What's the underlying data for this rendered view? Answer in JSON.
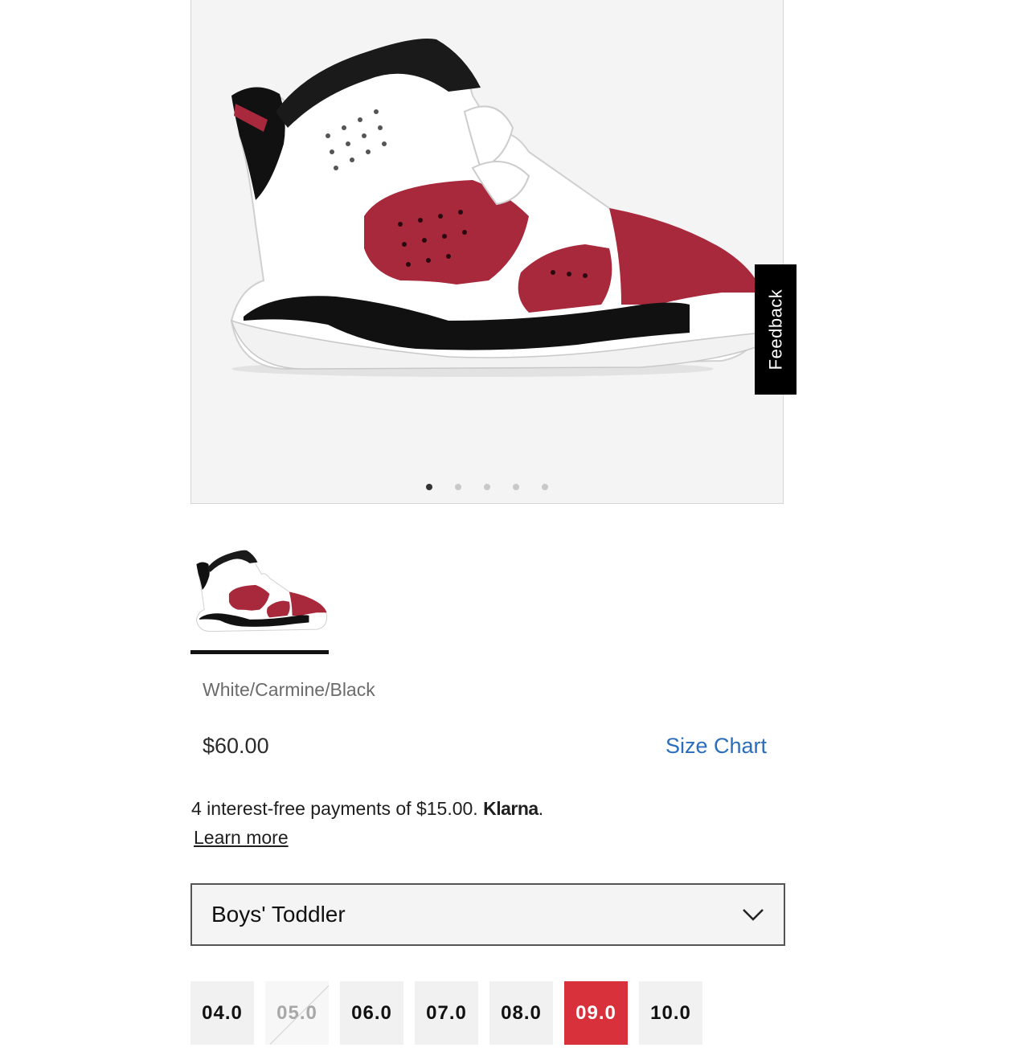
{
  "gallery": {
    "image": "product-shoe-image",
    "dots": 5,
    "active_dot": 1
  },
  "feedback": {
    "label": "Feedback"
  },
  "product": {
    "colorway": "White/Carmine/Black",
    "price": "$60.00",
    "size_chart_label": "Size Chart"
  },
  "klarna": {
    "text": "4 interest-free payments of $15.00.",
    "brand": "Klarna",
    "learn_more": "Learn more"
  },
  "size_category": {
    "selected": "Boys' Toddler"
  },
  "sizes": [
    {
      "label": "04.0",
      "state": "available"
    },
    {
      "label": "05.0",
      "state": "unavailable"
    },
    {
      "label": "06.0",
      "state": "available"
    },
    {
      "label": "07.0",
      "state": "available"
    },
    {
      "label": "08.0",
      "state": "available"
    },
    {
      "label": "09.0",
      "state": "selected"
    },
    {
      "label": "10.0",
      "state": "available"
    }
  ],
  "colors": {
    "accent_link": "#2a6ebb",
    "selected_size": "#d9313b",
    "carmine": "#a8283c"
  }
}
